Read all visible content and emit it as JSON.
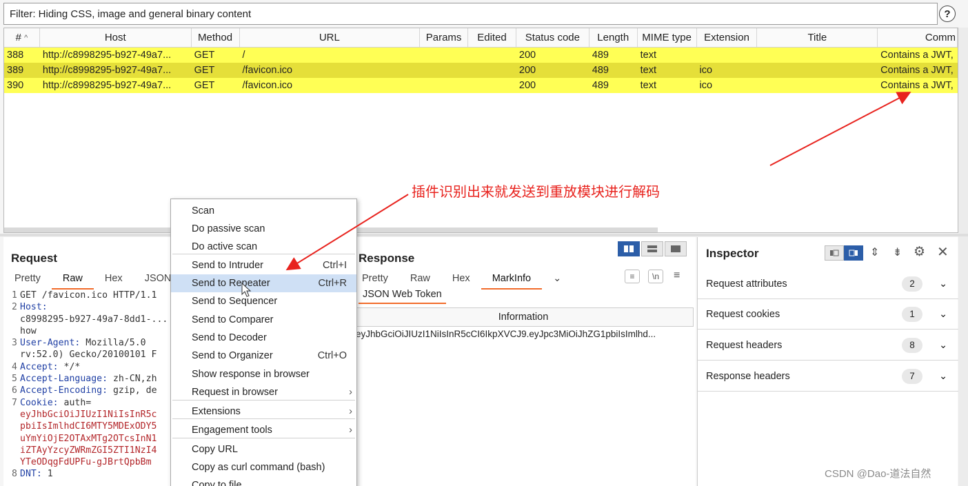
{
  "filter": {
    "text": "Filter: Hiding CSS, image and general binary content",
    "help_icon": "?"
  },
  "table": {
    "columns": [
      "#",
      "Host",
      "Method",
      "URL",
      "Params",
      "Edited",
      "Status code",
      "Length",
      "MIME type",
      "Extension",
      "Title",
      "Comm"
    ],
    "sort_indicator": "^",
    "rows": [
      {
        "num": "388",
        "host": "http://c8998295-b927-49a7...",
        "method": "GET",
        "url": "/",
        "status": "200",
        "length": "489",
        "mime": "text",
        "ext": "",
        "comment": "Contains a JWT,"
      },
      {
        "num": "389",
        "host": "http://c8998295-b927-49a7...",
        "method": "GET",
        "url": "/favicon.ico",
        "status": "200",
        "length": "489",
        "mime": "text",
        "ext": "ico",
        "comment": "Contains a JWT,"
      },
      {
        "num": "390",
        "host": "http://c8998295-b927-49a7...",
        "method": "GET",
        "url": "/favicon.ico",
        "status": "200",
        "length": "489",
        "mime": "text",
        "ext": "ico",
        "comment": "Contains a JWT,"
      }
    ],
    "row_colors": [
      "#ffff55",
      "#e5df39",
      "#ffff55"
    ]
  },
  "request": {
    "title": "Request",
    "tabs": [
      "Pretty",
      "Raw",
      "Hex",
      "JSON"
    ],
    "active_tab": "Raw",
    "lines": [
      {
        "n": "1",
        "key": "",
        "val": "GET /favicon.ico HTTP/1.1"
      },
      {
        "n": "2",
        "key": "Host:",
        "val": ""
      },
      {
        "n": "",
        "key": "",
        "val": "c8998295-b927-49a7-8dd1-..."
      },
      {
        "n": "",
        "key": "",
        "val": "how"
      },
      {
        "n": "3",
        "key": "User-Agent:",
        "val": " Mozilla/5.0"
      },
      {
        "n": "",
        "key": "",
        "val": "rv:52.0) Gecko/20100101 F"
      },
      {
        "n": "4",
        "key": "Accept:",
        "val": " */*"
      },
      {
        "n": "5",
        "key": "Accept-Language:",
        "val": " zh-CN,zh"
      },
      {
        "n": "6",
        "key": "Accept-Encoding:",
        "val": " gzip, de"
      },
      {
        "n": "7",
        "key": "Cookie:",
        "val": " auth="
      },
      {
        "n": "",
        "key": "",
        "val": "eyJhbGciOiJIUzI1NiIsInR5c",
        "cookie": true
      },
      {
        "n": "",
        "key": "",
        "val": "pbiIsImlhdCI6MTY5MDExODY5",
        "cookie": true
      },
      {
        "n": "",
        "key": "",
        "val": "uYmYiOjE2OTAxMTg2OTcsInN1",
        "cookie": true
      },
      {
        "n": "",
        "key": "",
        "val": "iZTAyYzcyZWRmZGI5ZTI1NzI4",
        "cookie": true
      },
      {
        "n": "",
        "key": "",
        "val": "YTeODqgFdUPFu-gJBrtQpbBm",
        "cookie": true
      },
      {
        "n": "8",
        "key": "DNT:",
        "val": " 1"
      }
    ]
  },
  "response": {
    "title": "Response",
    "tabs": [
      "Pretty",
      "Raw",
      "Hex",
      "MarkInfo"
    ],
    "active_tab": "MarkInfo",
    "subtab": "JSON Web Token",
    "info_header": "Information",
    "info_value": "eyJhbGciOiJIUzI1NiIsInR5cCI6IkpXVCJ9.eyJpc3MiOiJhZG1pbiIsImlhd..."
  },
  "inspector": {
    "title": "Inspector",
    "rows": [
      {
        "label": "Request attributes",
        "count": "2"
      },
      {
        "label": "Request cookies",
        "count": "1"
      },
      {
        "label": "Request headers",
        "count": "8"
      },
      {
        "label": "Response headers",
        "count": "7"
      }
    ]
  },
  "menu": {
    "items": [
      {
        "label": "Scan",
        "shortcut": "",
        "sub": false
      },
      {
        "label": "Do passive scan",
        "shortcut": "",
        "sub": false
      },
      {
        "label": "Do active scan",
        "shortcut": "",
        "sub": false
      },
      {
        "label": "Send to Intruder",
        "shortcut": "Ctrl+I",
        "sub": false
      },
      {
        "label": "Send to Repeater",
        "shortcut": "Ctrl+R",
        "sub": false,
        "highlight": true
      },
      {
        "label": "Send to Sequencer",
        "shortcut": "",
        "sub": false
      },
      {
        "label": "Send to Comparer",
        "shortcut": "",
        "sub": false
      },
      {
        "label": "Send to Decoder",
        "shortcut": "",
        "sub": false
      },
      {
        "label": "Send to Organizer",
        "shortcut": "Ctrl+O",
        "sub": false
      },
      {
        "label": "Show response in browser",
        "shortcut": "",
        "sub": false
      },
      {
        "label": "Request in browser",
        "shortcut": "",
        "sub": true
      },
      {
        "label": "Extensions",
        "shortcut": "",
        "sub": true
      },
      {
        "label": "Engagement tools",
        "shortcut": "",
        "sub": true
      },
      {
        "label": "Copy URL",
        "shortcut": "",
        "sub": false
      },
      {
        "label": "Copy as curl command (bash)",
        "shortcut": "",
        "sub": false
      },
      {
        "label": "Copy to file",
        "shortcut": "",
        "sub": false
      }
    ]
  },
  "annotation": "插件识别出来就发送到重放模块进行解码",
  "watermark": "CSDN @Dao-道法自然",
  "colors": {
    "accent_tab": "#f26b2a",
    "highlight_row": "#ffff55",
    "annotation": "#e8231e",
    "menu_highlight": "#cfe0f5"
  }
}
